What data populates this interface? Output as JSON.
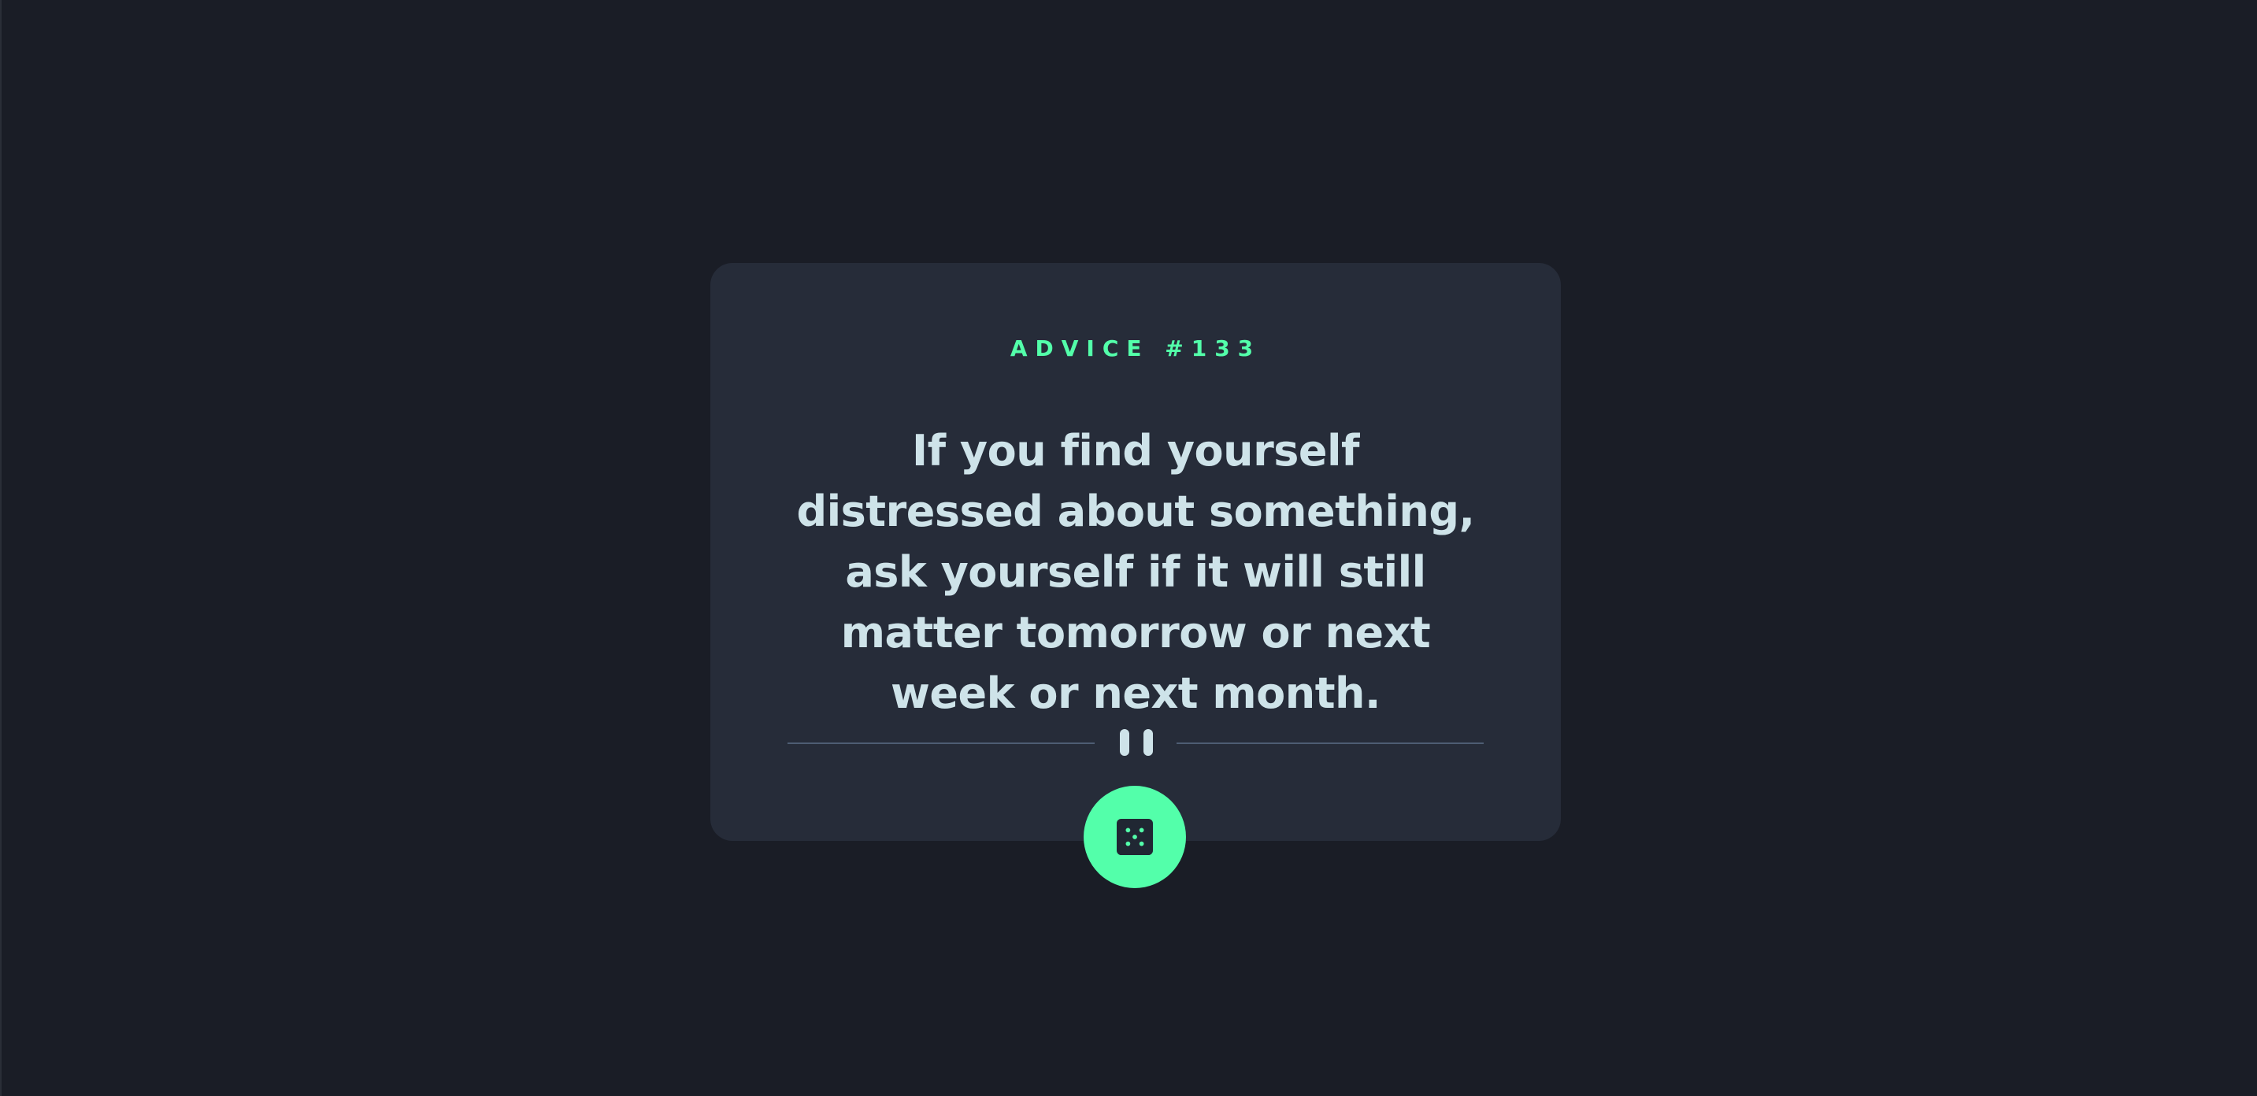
{
  "advice": {
    "label": "ADVICE #133",
    "text": "If you find yourself distressed about something, ask yourself if it will still matter tomorrow or next week or next month."
  },
  "colors": {
    "background": "#1a1d26",
    "card": "#262c39",
    "accent": "#53ffaa",
    "text": "#cee3e9",
    "divider": "#4e5d73"
  },
  "icons": {
    "divider": "pause-icon",
    "button": "dice-icon"
  }
}
